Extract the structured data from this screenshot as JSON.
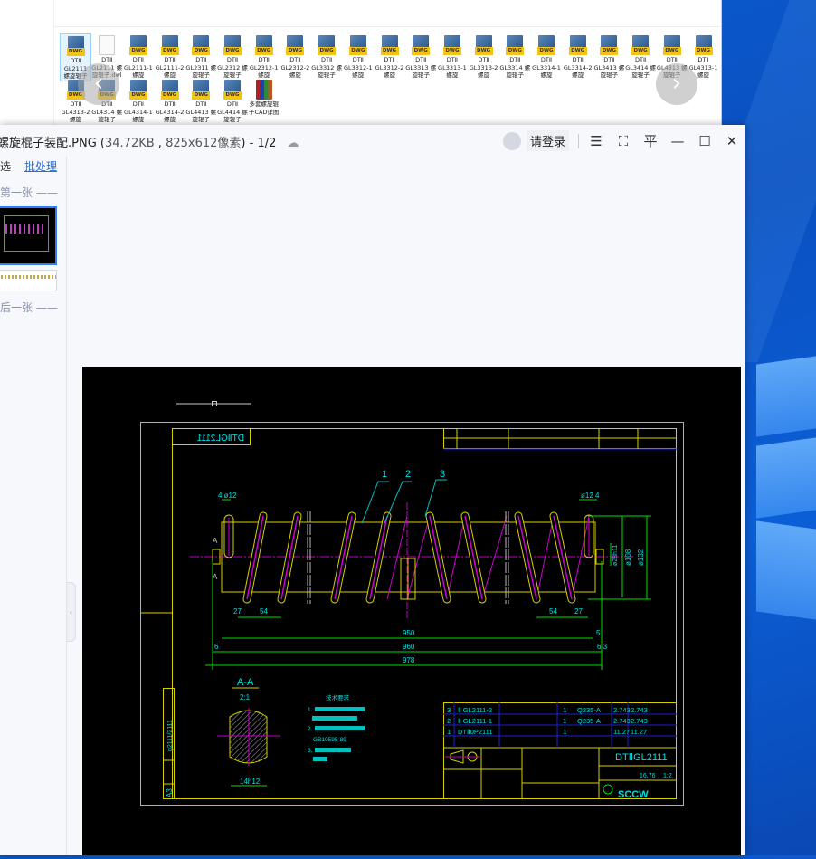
{
  "explorer": {
    "items": [
      {
        "l1": "DTⅡ",
        "l2": "GL2111 螺旋辊子",
        "type": "dwg",
        "selected": true
      },
      {
        "l1": "DTⅡ",
        "l2": "GL2111 螺旋辊子.dwl",
        "type": "blank"
      },
      {
        "l1": "DTⅡ",
        "l2": "GL2111-1 螺旋",
        "type": "dwg"
      },
      {
        "l1": "DTⅡ",
        "l2": "GL2111-2 螺旋",
        "type": "dwg"
      },
      {
        "l1": "DTⅡ",
        "l2": "GL2311 螺旋辊子",
        "type": "dwg"
      },
      {
        "l1": "DTⅡ",
        "l2": "GL2312 螺旋辊子",
        "type": "dwg"
      },
      {
        "l1": "DTⅡ",
        "l2": "GL2312-1 螺旋",
        "type": "dwg"
      },
      {
        "l1": "DTⅡ",
        "l2": "GL2312-2 螺旋",
        "type": "dwg"
      },
      {
        "l1": "DTⅡ",
        "l2": "GL3312 螺旋辊子",
        "type": "dwg"
      },
      {
        "l1": "DTⅡ",
        "l2": "GL3312-1 螺旋",
        "type": "dwg"
      },
      {
        "l1": "DTⅡ",
        "l2": "GL3312-2 螺旋",
        "type": "dwg"
      },
      {
        "l1": "DTⅡ",
        "l2": "GL3313 螺旋辊子",
        "type": "dwg"
      },
      {
        "l1": "DTⅡ",
        "l2": "GL3313-1 螺旋",
        "type": "dwg"
      },
      {
        "l1": "DTⅡ",
        "l2": "GL3313-2 螺旋",
        "type": "dwg"
      },
      {
        "l1": "DTⅡ",
        "l2": "GL3314 螺旋辊子",
        "type": "dwg"
      },
      {
        "l1": "DTⅡ",
        "l2": "GL3314-1 螺旋",
        "type": "dwg"
      },
      {
        "l1": "DTⅡ",
        "l2": "GL3314-2 螺旋",
        "type": "dwg"
      },
      {
        "l1": "DTⅡ",
        "l2": "GL3413 螺旋辊子",
        "type": "dwg"
      },
      {
        "l1": "DTⅡ",
        "l2": "GL3414 螺旋辊子",
        "type": "dwg"
      },
      {
        "l1": "DTⅡ",
        "l2": "GL4313 螺旋辊子",
        "type": "dwg"
      },
      {
        "l1": "DTⅡ",
        "l2": "GL4313-1 螺旋",
        "type": "dwg"
      },
      {
        "l1": "DTⅡ",
        "l2": "GL4313-2 螺旋",
        "type": "dwg"
      },
      {
        "l1": "DTⅡ",
        "l2": "GL4314 螺旋辊子",
        "type": "dwg"
      },
      {
        "l1": "DTⅡ",
        "l2": "GL4314-1 螺旋",
        "type": "dwg"
      },
      {
        "l1": "DTⅡ",
        "l2": "GL4314-2 螺旋",
        "type": "dwg"
      },
      {
        "l1": "DTⅡ",
        "l2": "GL4413 螺旋辊子",
        "type": "dwg"
      },
      {
        "l1": "DTⅡ",
        "l2": "GL4414 螺旋辊子",
        "type": "dwg"
      },
      {
        "l1": "多套螺旋辊子CAD详图",
        "l2": "",
        "type": "rar"
      }
    ],
    "icon_tag": "DWG",
    "prev_icon": "‹",
    "next_icon": "›"
  },
  "viewer": {
    "filename": "螺旋棍子装配.PNG",
    "filesize": "34.72KB",
    "dimensions": "825x612像素",
    "page": "1/2",
    "login": "请登录",
    "icons": {
      "menu": "☰",
      "fullscreen": "⛶",
      "pin": "平",
      "minimize": "—",
      "maximize": "☐",
      "close": "✕"
    }
  },
  "sidebar": {
    "select": "选",
    "batch": "批处理",
    "first": "第一张 ——",
    "last": "最后一张 ——"
  },
  "drawing": {
    "drawing_no": "DTⅡGL2111",
    "balloons": [
      "1",
      "2",
      "3"
    ],
    "dims": {
      "d12l": "4  ø12",
      "d12r": "ø12  4",
      "d27": "27",
      "d54": "54",
      "d950": "950",
      "d960": "960",
      "d978": "978",
      "d6": "6",
      "d5": "5",
      "d63": "6  3",
      "d28": "ø28h11",
      "d108": "ø108",
      "d132": "ø132",
      "d14": "14h12"
    },
    "section_mark": "A",
    "section_title": "A-A",
    "section_scale": "2:1",
    "tech_req": [
      "技术要求",
      "1.",
      "2.",
      "GB10595-89",
      "3."
    ],
    "parts": [
      {
        "no": "3",
        "code": "Ⅱ GL2111-2",
        "mat": "Q235-A",
        "w1": "2.743",
        "w2": "2.743"
      },
      {
        "no": "2",
        "code": "Ⅱ GL2111-1",
        "mat": "Q235-A",
        "w1": "2.743",
        "w2": "2.743"
      },
      {
        "no": "1",
        "code": "DTⅡ0P2111",
        "mat": "",
        "w1": "11.27",
        "w2": "11.27"
      }
    ],
    "qty": "1",
    "weight": "16.76",
    "scale": "1:2",
    "title_no": "DTⅡGL2111",
    "company": "SCCW",
    "sheet": "A3",
    "side_code": "g2111/2111"
  }
}
